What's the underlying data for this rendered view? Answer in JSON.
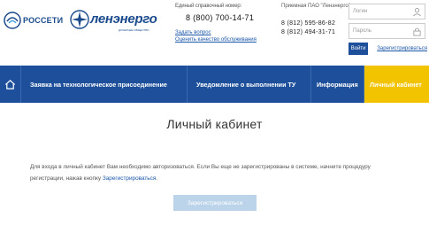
{
  "header": {
    "logo_rosseti": "РОССЕТИ",
    "logo_lenenergo": "ленэнерго",
    "logo_lenenergo_sub": "ДОЧЕРНЕЕ ОБЩЕСТВО",
    "contact": {
      "caption": "Единый справочный номер:",
      "phone": "8 (800) 700-14-71",
      "link1": "Задать вопрос",
      "link2": "Оценить качество обслуживания"
    },
    "office": {
      "caption": "Приемная ПАО \"Ленэнерго\"",
      "phone1": "8 (812) 595-86-82",
      "phone2": "8 (812) 494-31-71"
    },
    "login": {
      "login_placeholder": "Логин",
      "password_placeholder": "Пароль",
      "submit_label": "Войти",
      "register_link": "Зарегистрироваться"
    }
  },
  "nav": {
    "items": [
      {
        "label": "Заявка на технологическое присоединение"
      },
      {
        "label": "Уведомление о выполнении ТУ"
      },
      {
        "label": "Информация"
      },
      {
        "label": "Личный кабинет"
      }
    ]
  },
  "main": {
    "title": "Личный кабинет",
    "message_part1": "Для входа в личный кабинет Вам необходимо авторизоваться. Если Вы еще не зарегистрированы в системе, начните",
    "message_part2": "процедуру регистрации, нажав кнопку ",
    "message_link": "Зарегистрироваться",
    "message_end": ".",
    "register_button": "Зарегистрироваться"
  },
  "colors": {
    "brand_blue": "#1d4f9a",
    "active_tab": "#f2c400",
    "button_disabled": "#bcd4ea"
  }
}
